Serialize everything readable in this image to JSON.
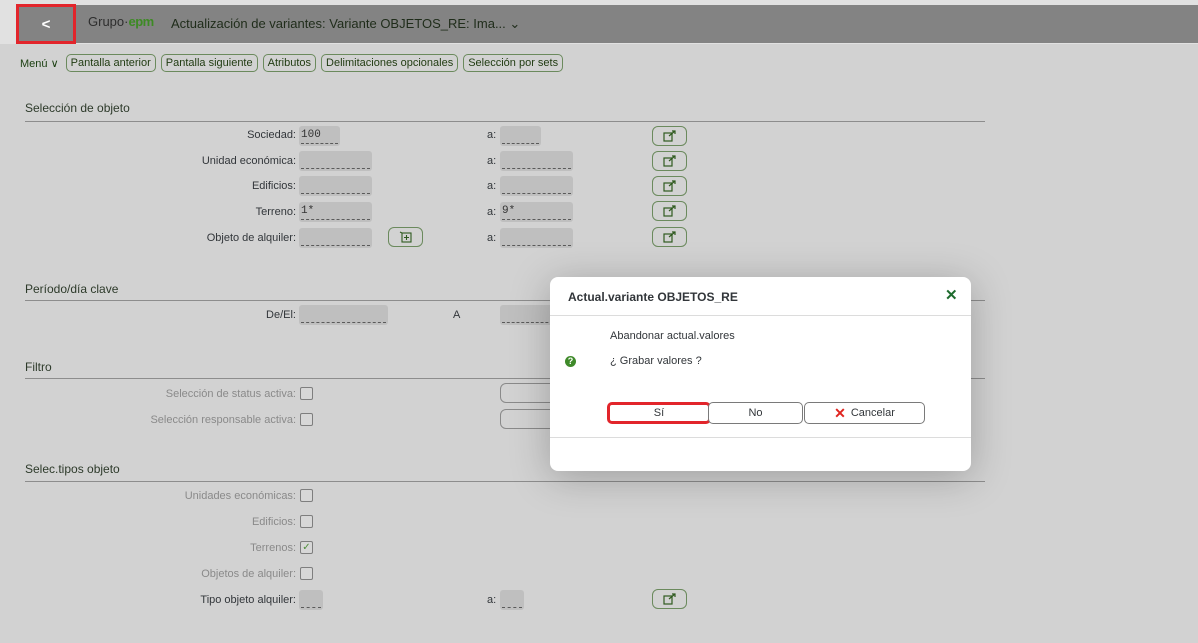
{
  "shell": {
    "back": "<",
    "logo_a": "Grupo·",
    "logo_b": "epm",
    "title": "Actualización de variantes: Variante OBJETOS_RE: Ima...",
    "title_chevron": "⌄"
  },
  "toolbar": {
    "menu": "Menú",
    "menu_chevron": "∨",
    "buttons": [
      "Pantalla anterior",
      "Pantalla siguiente",
      "Atributos",
      "Delimitaciones opcionales",
      "Selección por sets"
    ]
  },
  "seleccion_objeto": {
    "title": "Selección de objeto",
    "rows": [
      {
        "label": "Sociedad:",
        "from": "100",
        "to": "",
        "a": "a:"
      },
      {
        "label": "Unidad económica:",
        "from": "",
        "to": "",
        "a": "a:"
      },
      {
        "label": "Edificios:",
        "from": "",
        "to": "",
        "a": "a:"
      },
      {
        "label": "Terreno:",
        "from": "1*",
        "to": "9*",
        "a": "a:"
      },
      {
        "label": "Objeto de alquiler:",
        "from": "",
        "to": "",
        "a": "a:"
      }
    ]
  },
  "periodo": {
    "title": "Período/día clave",
    "label": "De/El:",
    "a_label": "A",
    "from": ""
  },
  "filtro": {
    "title": "Filtro",
    "items": [
      "Selección de status activa:",
      "Selección responsable activa:"
    ]
  },
  "tipos": {
    "title": "Selec.tipos objeto",
    "items": [
      {
        "label": "Unidades económicas:",
        "checked": false
      },
      {
        "label": "Edificios:",
        "checked": false
      },
      {
        "label": "Terrenos:",
        "checked": true
      },
      {
        "label": "Objetos de alquiler:",
        "checked": false
      }
    ],
    "tipo_label": "Tipo objeto alquiler:",
    "tipo_a": "a:",
    "check_mark": "✓"
  },
  "dialog": {
    "title": "Actual.variante OBJETOS_RE",
    "close": "✕",
    "message1": "Abandonar actual.valores",
    "message2": "¿ Grabar valores ?",
    "q_icon": "?",
    "btn_yes": "Sí",
    "btn_no": "No",
    "btn_cancel": "Cancelar",
    "cancel_icon": "✕"
  }
}
